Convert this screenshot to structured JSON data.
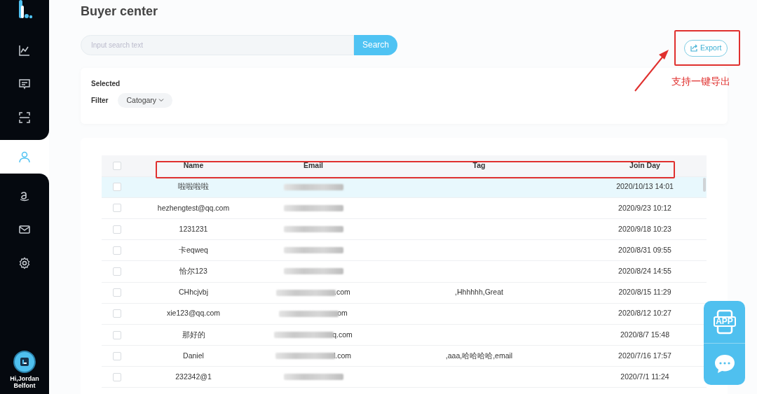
{
  "sidebar": {
    "items": [
      {
        "kind": "chart",
        "selected": false
      },
      {
        "kind": "message",
        "selected": false
      },
      {
        "kind": "scan",
        "selected": false
      },
      {
        "kind": "user",
        "selected": true
      },
      {
        "kind": "amazon",
        "selected": false
      },
      {
        "kind": "mail",
        "selected": false
      },
      {
        "kind": "settings",
        "selected": false
      }
    ],
    "user": {
      "greeting": "Hi,Jordan Belfont"
    }
  },
  "page": {
    "title": "Buyer center"
  },
  "search": {
    "placeholder": "Input search text",
    "button": "Search"
  },
  "export": {
    "label": "Export"
  },
  "annotation": {
    "caption": "支持一键导出"
  },
  "filter_card": {
    "selected_label": "Selected",
    "filter_label": "Filter",
    "dropdown": "Catogary"
  },
  "table": {
    "select_all_checked": false,
    "columns": [
      "Name",
      "Email",
      "Tag",
      "Join Day"
    ],
    "rows": [
      {
        "name": "啦啦啦啦",
        "email_visible": "",
        "tag": "",
        "join_day": "2020/10/13 14:01",
        "highlighted": true,
        "checked": false
      },
      {
        "name": "hezhengtest@qq.com",
        "email_visible": "",
        "tag": "",
        "join_day": "2020/9/23 10:12",
        "highlighted": false,
        "checked": false
      },
      {
        "name": "1231231",
        "email_visible": "",
        "tag": "",
        "join_day": "2020/9/18 10:23",
        "highlighted": false,
        "checked": false
      },
      {
        "name": "卡eqweq",
        "email_visible": "",
        "tag": "",
        "join_day": "2020/8/31 09:55",
        "highlighted": false,
        "checked": false
      },
      {
        "name": "恰尔123",
        "email_visible": "",
        "tag": "",
        "join_day": "2020/8/24 14:55",
        "highlighted": false,
        "checked": false
      },
      {
        "name": "CHhcjvbj",
        "email_visible": ".com",
        "tag": ",Hhhhhh,Great",
        "join_day": "2020/8/15 11:29",
        "highlighted": false,
        "checked": false
      },
      {
        "name": "xie123@qq.com",
        "email_visible": "om",
        "tag": "",
        "join_day": "2020/8/12 10:27",
        "highlighted": false,
        "checked": false
      },
      {
        "name": "那好的",
        "email_visible": "q.com",
        "tag": "",
        "join_day": "2020/8/7 15:48",
        "highlighted": false,
        "checked": false
      },
      {
        "name": "Daniel",
        "email_visible": "l.com",
        "tag": ",aaa,哈哈哈哈,email",
        "join_day": "2020/7/16 17:57",
        "highlighted": false,
        "checked": false
      },
      {
        "name": "232342@1",
        "email_visible": "",
        "tag": "",
        "join_day": "2020/7/1 11:24",
        "highlighted": false,
        "checked": false
      }
    ]
  },
  "floating": {
    "app_label": "APP"
  }
}
